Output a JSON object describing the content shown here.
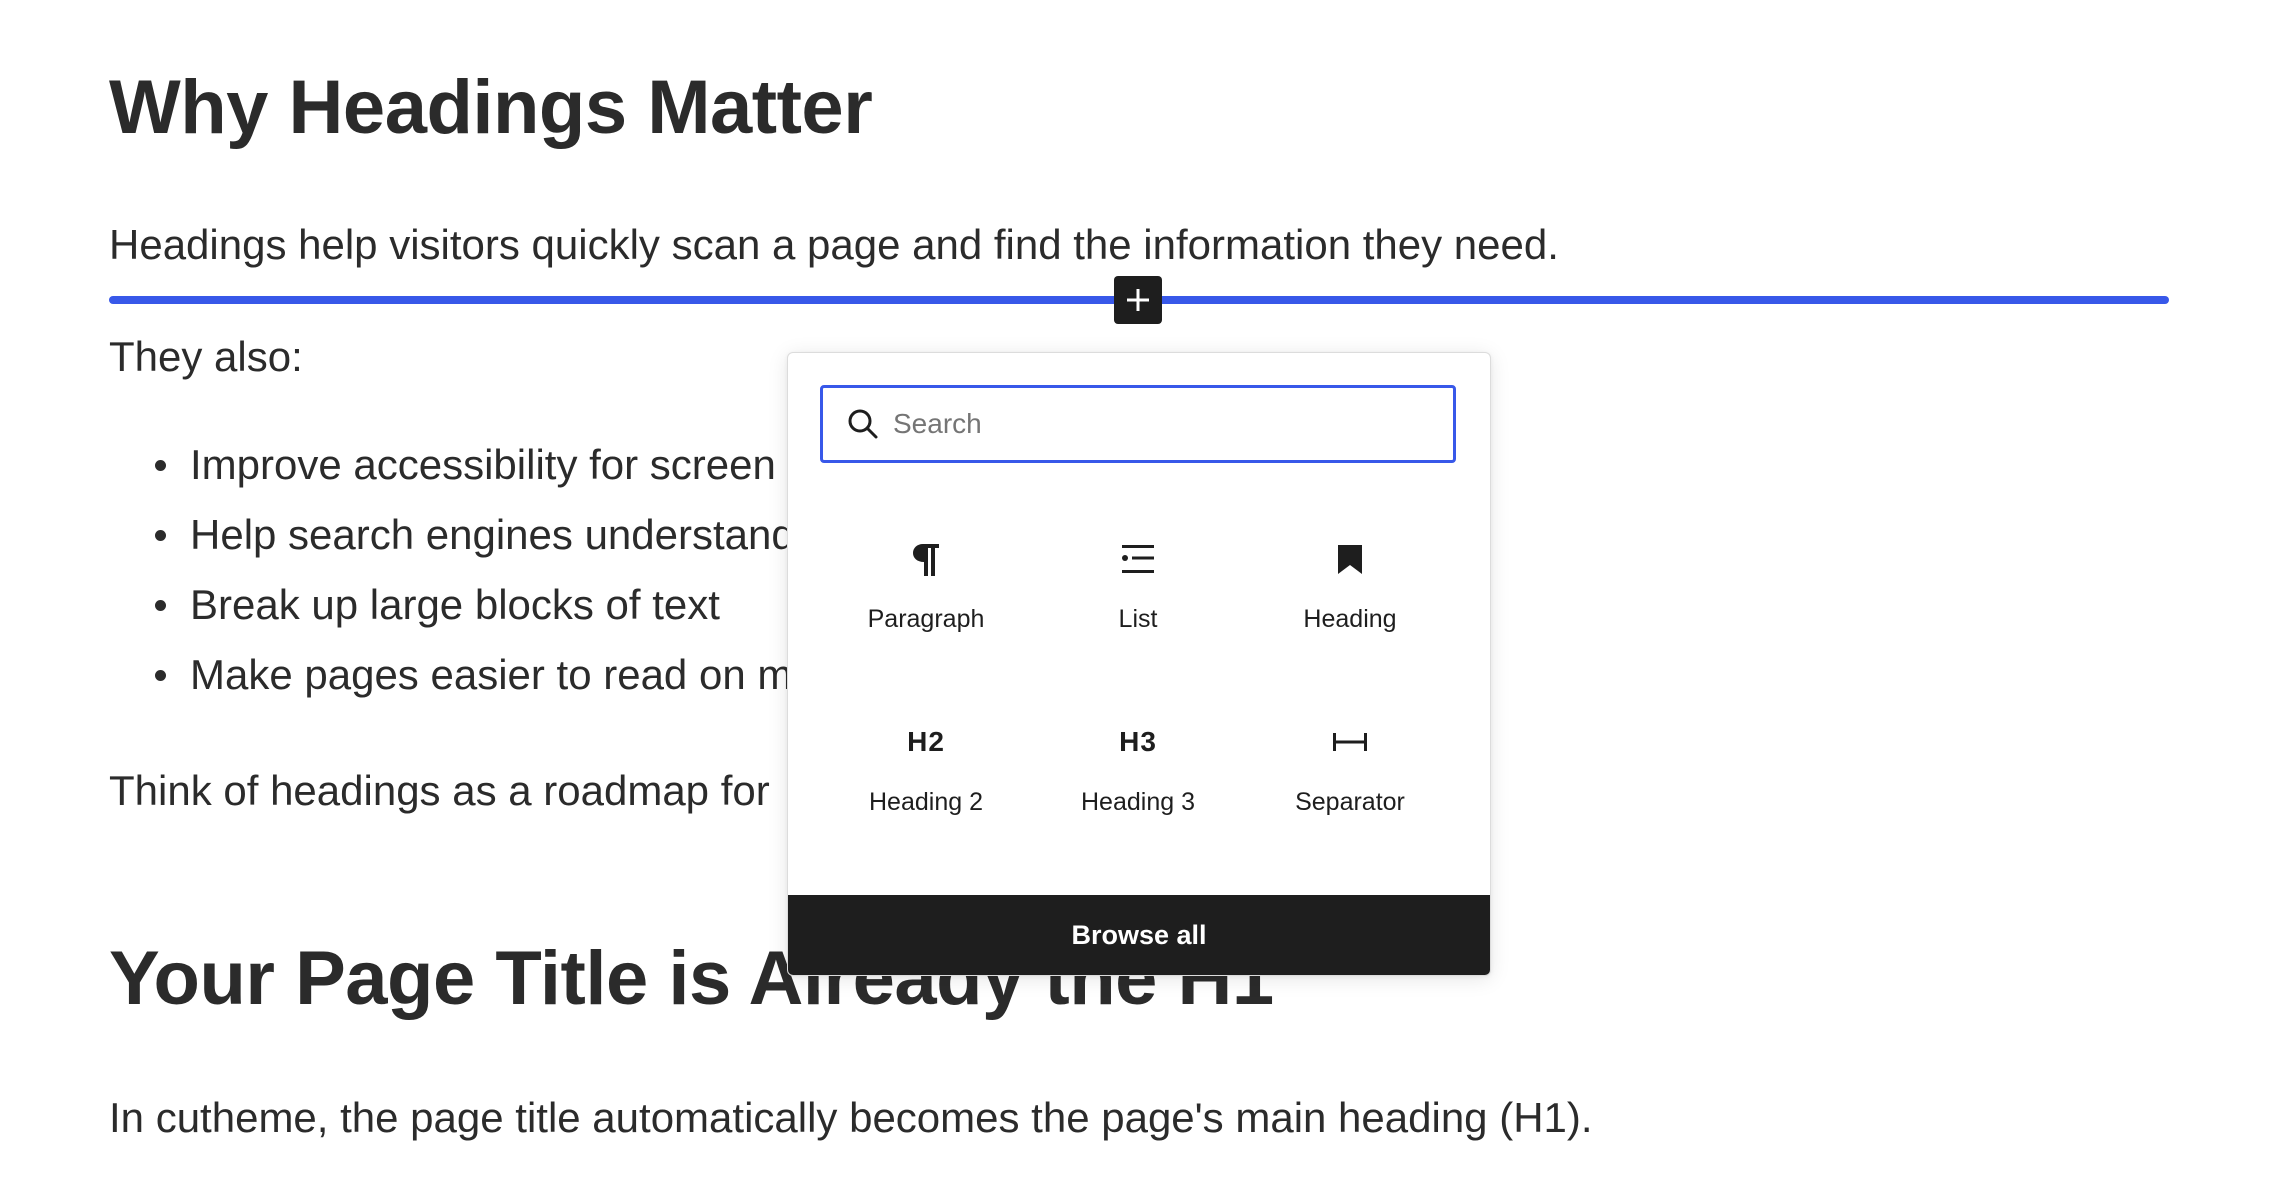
{
  "document": {
    "heading_1": "Why Headings Matter",
    "paragraph_1": "Headings help visitors quickly scan a page and find the information they need.",
    "paragraph_2": "They also:",
    "list_items": [
      "Improve accessibility for screen",
      "Help search engines understand",
      "Break up large blocks of text",
      "Make pages easier to read on m"
    ],
    "paragraph_3": "Think of headings as a roadmap for",
    "heading_2": "Your Page Title is Already the H1",
    "paragraph_4": "In cutheme, the page title automatically becomes the page's main heading (H1)."
  },
  "inserter": {
    "add_icon": "plus-icon",
    "search": {
      "placeholder": "Search",
      "value": "",
      "icon": "search-icon"
    },
    "blocks": [
      {
        "label": "Paragraph",
        "icon": "paragraph-icon"
      },
      {
        "label": "List",
        "icon": "list-icon"
      },
      {
        "label": "Heading",
        "icon": "bookmark-icon"
      },
      {
        "label": "Heading 2",
        "icon": "h2-icon",
        "icon_text": "H2"
      },
      {
        "label": "Heading 3",
        "icon": "h3-icon",
        "icon_text": "H3"
      },
      {
        "label": "Separator",
        "icon": "separator-icon"
      }
    ],
    "browse_all_label": "Browse all"
  },
  "colors": {
    "accent": "#3858e9",
    "dark": "#1e1e1e",
    "text": "#2b2b2b"
  }
}
